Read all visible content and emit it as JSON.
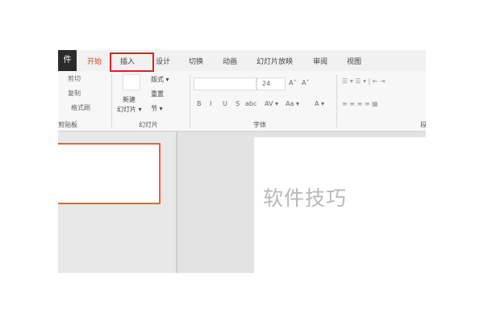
{
  "tabs": {
    "file": "件",
    "home": "开始",
    "insert": "插入",
    "design": "设计",
    "transitions": "切换",
    "animations": "动画",
    "slideshow": "幻灯片放映",
    "review": "审阅",
    "view": "视图"
  },
  "clipboard": {
    "cut": "剪切",
    "copy": "复制",
    "format_painter": "格式刷",
    "label": "剪贴板"
  },
  "slides": {
    "new_slide": "新建",
    "new_slide2": "幻灯片 ▾",
    "layout": "版式 ▾",
    "reset": "重置",
    "section": "节 ▾",
    "label": "幻灯片"
  },
  "font": {
    "size": "24",
    "bold": "B",
    "italic": "I",
    "underline": "U",
    "strike": "S",
    "abc": "abc",
    "spacing": "AV ▾",
    "case": "Aa ▾",
    "color": "A ▾",
    "grow": "A˄",
    "shrink": "A˅",
    "label": "字体"
  },
  "paragraph": {
    "label": "段"
  },
  "watermark": "软件技巧"
}
